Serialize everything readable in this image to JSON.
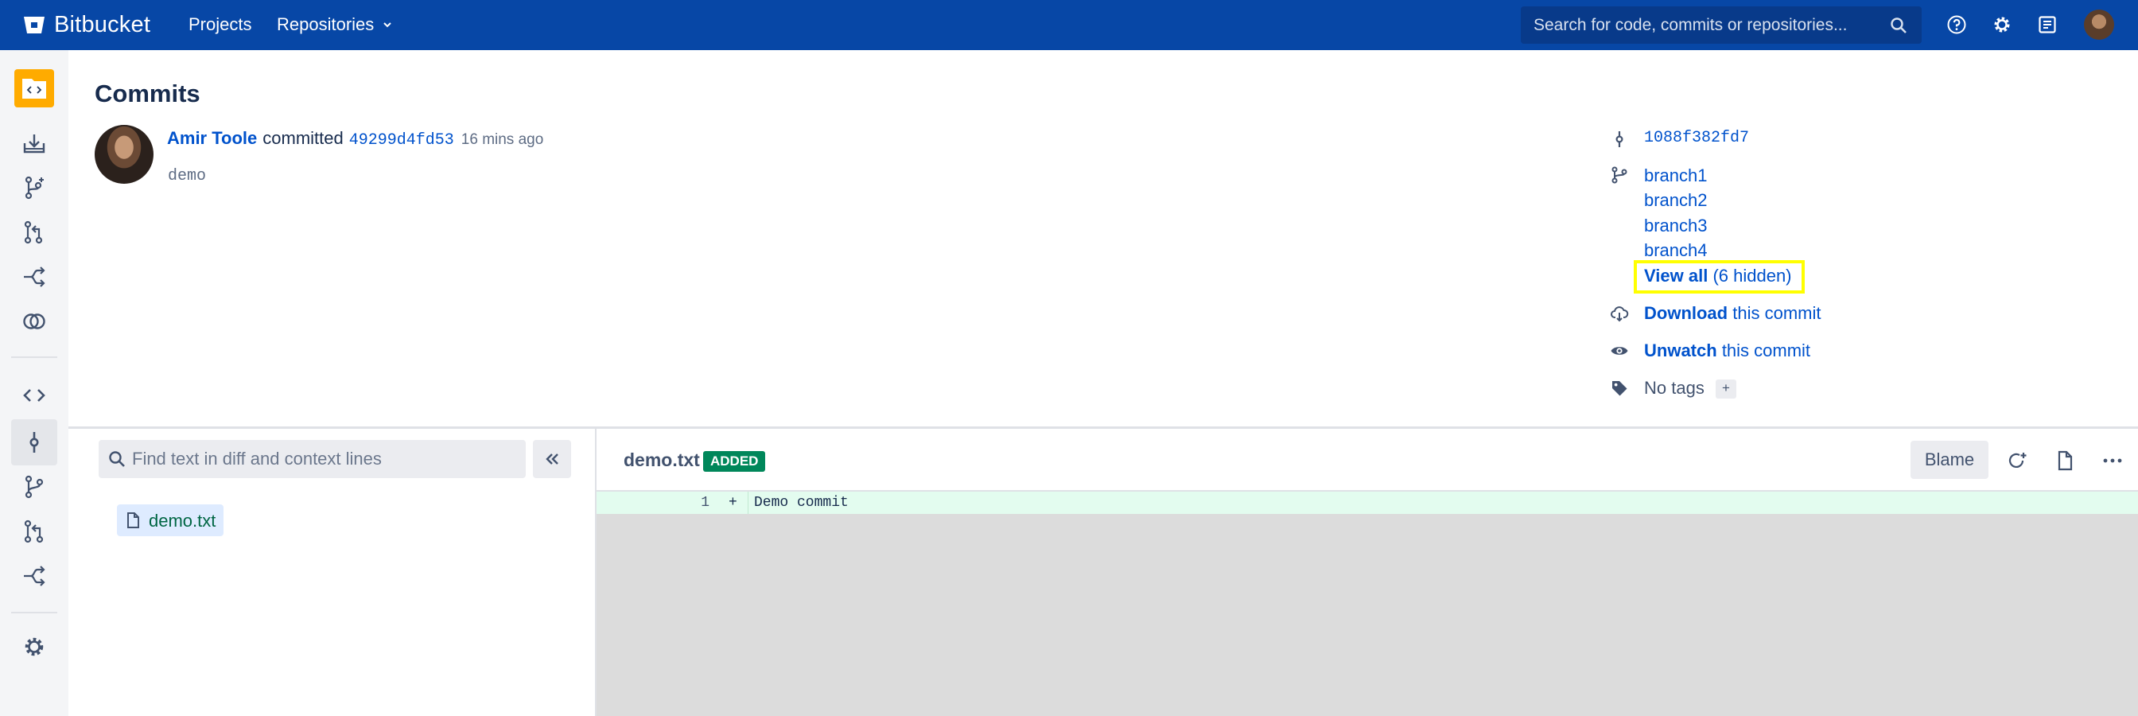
{
  "topnav": {
    "brand": "Bitbucket",
    "links": {
      "projects": "Projects",
      "repositories": "Repositories"
    },
    "search_placeholder": "Search for code, commits or repositories...",
    "background": "#0747a6"
  },
  "page": {
    "title": "Commits"
  },
  "commit": {
    "author": "Amir Toole",
    "verb": "committed",
    "hash": "49299d4fd53",
    "time": "16 mins ago",
    "message": "demo"
  },
  "meta": {
    "parent_hash": "1088f382fd7",
    "branches": [
      "branch1",
      "branch2",
      "branch3",
      "branch4"
    ],
    "view_all": {
      "label": "View all",
      "count": "(6 hidden)"
    },
    "download": {
      "action": "Download",
      "rest": "this commit"
    },
    "unwatch": {
      "action": "Unwatch",
      "rest": "this commit"
    },
    "tags": {
      "label": "No tags",
      "add": "+"
    }
  },
  "filetree": {
    "filter_placeholder": "Find text in diff and context lines",
    "files": [
      "demo.txt"
    ]
  },
  "diff": {
    "filename": "demo.txt",
    "badge": "ADDED",
    "blame_label": "Blame",
    "lines": [
      {
        "number": "1",
        "sign": "+",
        "code": "Demo commit"
      }
    ]
  },
  "colors": {
    "link": "#0052cc",
    "added_badge": "#00875a",
    "added_line": "#e3fcef",
    "highlight_box": "#ffff00",
    "project_avatar": "#ffab00"
  },
  "icons": {
    "top": [
      "help-icon",
      "settings-icon",
      "notifications-icon"
    ],
    "sidebar": [
      "clone-icon",
      "create-branch-icon",
      "create-pull-request-icon",
      "fork-icon",
      "compare-icon",
      "source-icon",
      "commits-icon",
      "branches-icon",
      "pull-requests-icon",
      "forks-icon",
      "repository-settings-icon"
    ]
  }
}
